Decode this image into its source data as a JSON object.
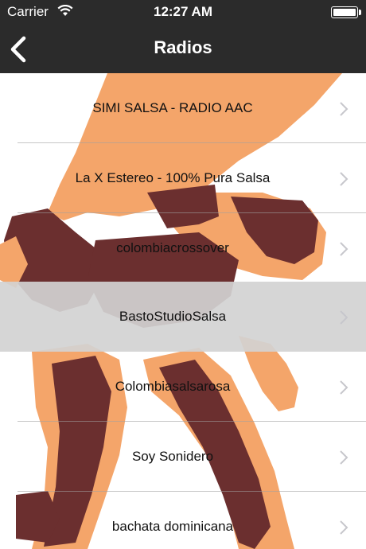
{
  "status_bar": {
    "carrier": "Carrier",
    "time": "12:27 AM",
    "wifi_icon": "wifi-icon",
    "battery_icon": "battery-icon"
  },
  "nav": {
    "title": "Radios",
    "back_icon": "chevron-left-icon"
  },
  "colors": {
    "bar": "#2b2b2b",
    "art_skin": "#f4a56a",
    "art_dark": "#6b2f2f",
    "selected_row": "#d2d2d2"
  },
  "radios": [
    {
      "label": "SIMI SALSA - RADIO AAC",
      "selected": false
    },
    {
      "label": "La X Estereo - 100% Pura Salsa",
      "selected": false
    },
    {
      "label": "colombiacrossover",
      "selected": false
    },
    {
      "label": "BastoStudioSalsa",
      "selected": true
    },
    {
      "label": "Colombiasalsarosa",
      "selected": false
    },
    {
      "label": "Soy Sonidero",
      "selected": false
    },
    {
      "label": "bachata dominicana",
      "selected": false
    }
  ]
}
